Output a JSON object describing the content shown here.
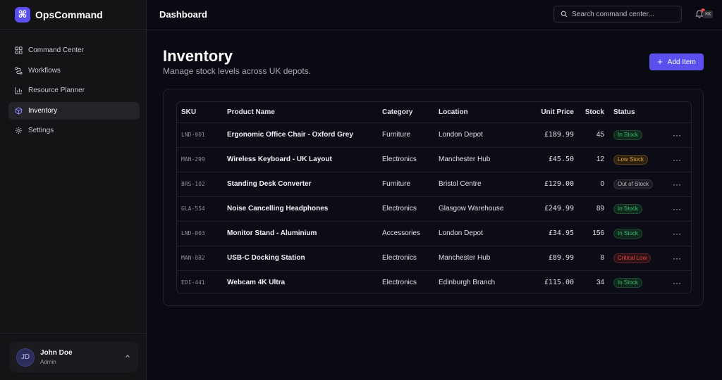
{
  "app": {
    "name": "OpsCommand",
    "logo_glyph": "⌘",
    "accent": "#5b4ff0"
  },
  "sidebar": {
    "items": [
      {
        "label": "Command Center",
        "icon": "grid-icon",
        "active": false
      },
      {
        "label": "Workflows",
        "icon": "workflow-icon",
        "active": false
      },
      {
        "label": "Resource Planner",
        "icon": "bar-chart-icon",
        "active": false
      },
      {
        "label": "Inventory",
        "icon": "box-icon",
        "active": true
      },
      {
        "label": "Settings",
        "icon": "gear-icon",
        "active": false
      }
    ],
    "user": {
      "initials": "JD",
      "name": "John Doe",
      "role": "Admin"
    }
  },
  "header": {
    "title": "Dashboard",
    "search_placeholder": "Search command center...",
    "shortcut": "⌘K",
    "notification_icon": "bell-icon"
  },
  "main": {
    "title": "Inventory",
    "subtitle": "Manage stock levels across UK depots.",
    "add_button_label": "Add Item",
    "columns": [
      "SKU",
      "Product Name",
      "Category",
      "Location",
      "Unit Price",
      "Stock",
      "Status"
    ],
    "rows": [
      {
        "sku": "LND-001",
        "name": "Ergonomic Office Chair - Oxford Grey",
        "category": "Furniture",
        "location": "London Depot",
        "price": "£189.99",
        "stock": "45",
        "status": "In Stock",
        "status_kind": "in"
      },
      {
        "sku": "MAN-299",
        "name": "Wireless Keyboard - UK Layout",
        "category": "Electronics",
        "location": "Manchester Hub",
        "price": "£45.50",
        "stock": "12",
        "status": "Low Stock",
        "status_kind": "low"
      },
      {
        "sku": "BRS-102",
        "name": "Standing Desk Converter",
        "category": "Furniture",
        "location": "Bristol Centre",
        "price": "£129.00",
        "stock": "0",
        "status": "Out of Stock",
        "status_kind": "out"
      },
      {
        "sku": "GLA-554",
        "name": "Noise Cancelling Headphones",
        "category": "Electronics",
        "location": "Glasgow Warehouse",
        "price": "£249.99",
        "stock": "89",
        "status": "In Stock",
        "status_kind": "in"
      },
      {
        "sku": "LND-003",
        "name": "Monitor Stand - Aluminium",
        "category": "Accessories",
        "location": "London Depot",
        "price": "£34.95",
        "stock": "156",
        "status": "In Stock",
        "status_kind": "in"
      },
      {
        "sku": "MAN-882",
        "name": "USB-C Docking Station",
        "category": "Electronics",
        "location": "Manchester Hub",
        "price": "£89.99",
        "stock": "8",
        "status": "Critical Low",
        "status_kind": "crit"
      },
      {
        "sku": "EDI-441",
        "name": "Webcam 4K Ultra",
        "category": "Electronics",
        "location": "Edinburgh Branch",
        "price": "£115.00",
        "stock": "34",
        "status": "In Stock",
        "status_kind": "in"
      }
    ],
    "row_action_glyph": "···"
  }
}
